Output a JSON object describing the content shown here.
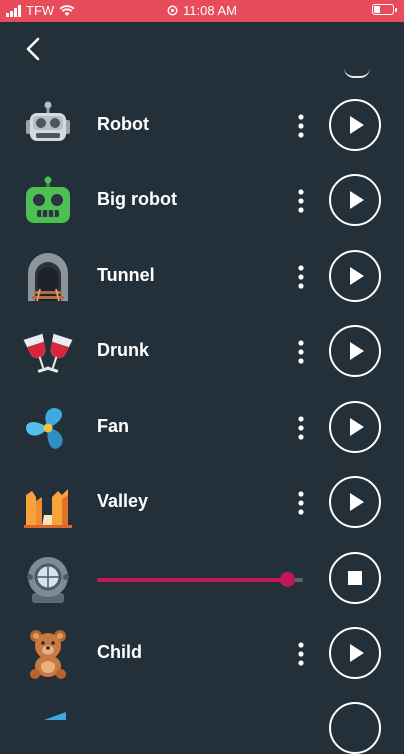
{
  "status_bar": {
    "carrier": "TFW",
    "time": "11:08 AM"
  },
  "items": [
    {
      "label": "Robot",
      "icon": "robot-icon",
      "state": "play"
    },
    {
      "label": "Big robot",
      "icon": "big-robot-icon",
      "state": "play"
    },
    {
      "label": "Tunnel",
      "icon": "tunnel-icon",
      "state": "play"
    },
    {
      "label": "Drunk",
      "icon": "wine-glasses-icon",
      "state": "play"
    },
    {
      "label": "Fan",
      "icon": "fan-icon",
      "state": "play"
    },
    {
      "label": "Valley",
      "icon": "valley-icon",
      "state": "play"
    },
    {
      "label": "",
      "icon": "diver-helmet-icon",
      "state": "playing",
      "progress": 0.92
    },
    {
      "label": "Child",
      "icon": "teddy-bear-icon",
      "state": "play"
    }
  ],
  "colors": {
    "background": "#23303a",
    "status_bar": "#e84c5a",
    "accent": "#c2185b"
  }
}
